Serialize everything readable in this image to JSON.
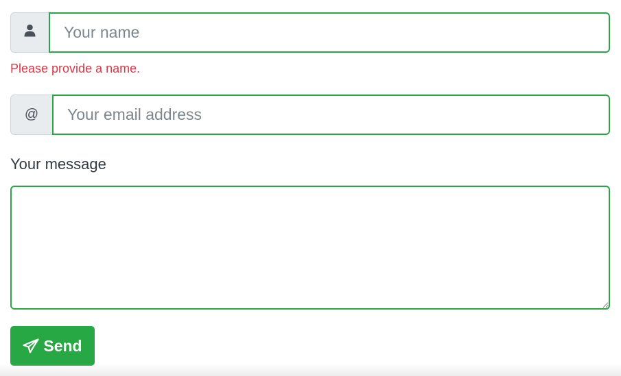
{
  "name": {
    "icon": "user-icon",
    "placeholder": "Your name",
    "value": "",
    "error": "Please provide a name."
  },
  "email": {
    "addon_text": "@",
    "placeholder": "Your email address",
    "value": ""
  },
  "message": {
    "label": "Your message",
    "value": ""
  },
  "send_button": {
    "icon": "paper-plane-icon",
    "label": "Send"
  },
  "colors": {
    "valid_border": "#28a745",
    "error_text": "#dc3545",
    "addon_background": "#e9ecef",
    "button_background": "#28a745"
  }
}
